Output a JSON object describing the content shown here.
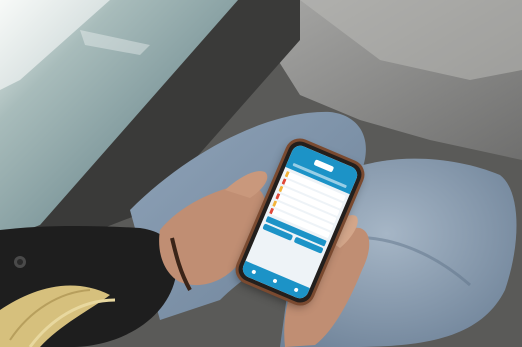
{
  "photo": {
    "subject": "phone-in-hands",
    "colors": {
      "window_glass": "#5e7f86",
      "seat_fabric": "#8e8e8e",
      "jeans": "#7f94ab",
      "jacket": "#1d1d1d",
      "skin": "#c08e73",
      "hair": "#d6c07d",
      "phone_case": "#7a4a30",
      "app_primary": "#1c93c7",
      "app_highlight": "#f2b33a",
      "app_alert": "#e0493a"
    }
  }
}
